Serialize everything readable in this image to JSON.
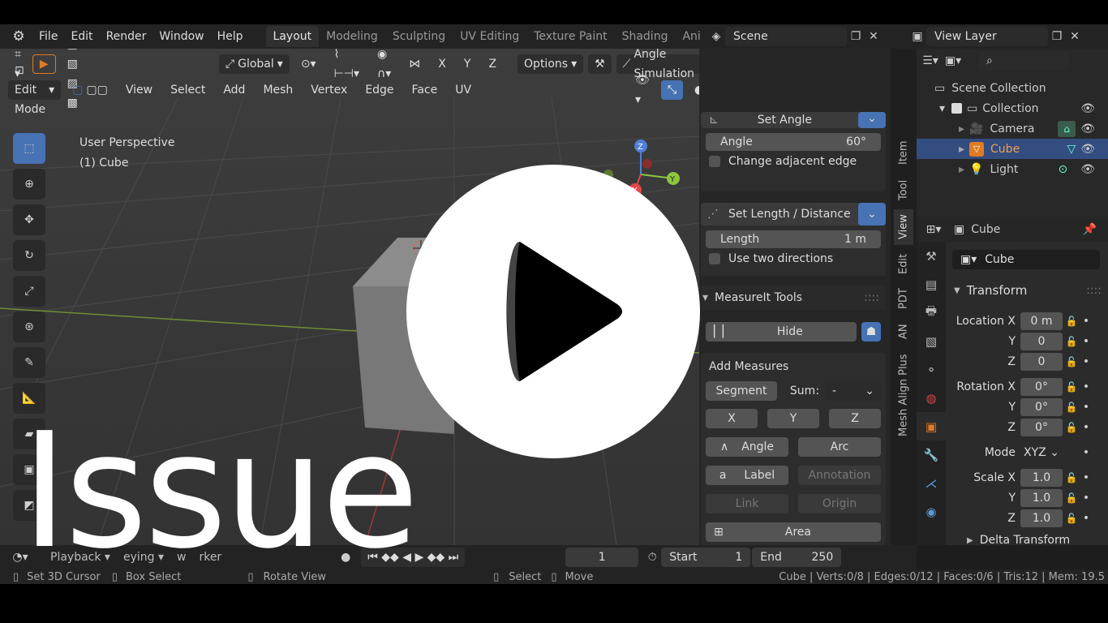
{
  "menu": [
    "File",
    "Edit",
    "Render",
    "Window",
    "Help"
  ],
  "workspaces": [
    "Layout",
    "Modeling",
    "Sculpting",
    "UV Editing",
    "Texture Paint",
    "Shading",
    "Ani"
  ],
  "scene": "Scene",
  "view_layer": "View Layer",
  "header1": {
    "transform": "Global",
    "options": "Options",
    "angle_sim": "Angle Simulation",
    "axes": [
      "X",
      "Y",
      "Z"
    ]
  },
  "header2": {
    "mode": "Edit Mode",
    "items": [
      "View",
      "Select",
      "Add",
      "Mesh",
      "Vertex",
      "Edge",
      "Face",
      "UV"
    ]
  },
  "viewport": {
    "perspective": "User Perspective",
    "object": "(1) Cube"
  },
  "sidebar": {
    "set_angle": "Set Angle",
    "angle_label": "Angle",
    "angle_value": "60°",
    "change_adjacent": "Change adjacent edge",
    "set_length": "Set Length / Distance",
    "length_label": "Length",
    "length_value": "1 m",
    "two_dirs": "Use two directions",
    "measureit": "MeasureIt Tools",
    "hide": "Hide",
    "add_measures": "Add Measures",
    "segment": "Segment",
    "sum": "Sum:",
    "sum_val": "-",
    "x": "X",
    "y": "Y",
    "z": "Z",
    "angle_btn": "Angle",
    "arc": "Arc",
    "label": "Label",
    "annotation": "Annotation",
    "link": "Link",
    "origin": "Origin",
    "area": "Area",
    "tabs": [
      "Item",
      "Tool",
      "View",
      "Edit",
      "PDT",
      "AN",
      "Mesh Align Plus"
    ]
  },
  "outliner": {
    "scene_collection": "Scene Collection",
    "collection": "Collection",
    "items": [
      "Camera",
      "Cube",
      "Light"
    ]
  },
  "properties": {
    "header_obj": "Cube",
    "name": "Cube",
    "transform": "Transform",
    "location_x": "Location X",
    "loc_x": "0 m",
    "loc_y": "0",
    "loc_z": "0",
    "rotation_x": "Rotation X",
    "rot_x": "0°",
    "rot_y": "0°",
    "rot_z": "0°",
    "mode": "Mode",
    "mode_val": "XYZ",
    "scale_x": "Scale X",
    "sc_x": "1.0",
    "sc_y": "1.0",
    "sc_z": "1.0",
    "delta": "Delta Transform",
    "y": "Y",
    "z": "Z"
  },
  "timeline": {
    "playback": "Playback",
    "keying": "eying",
    "view": "w",
    "marker": "rker",
    "frame": "1",
    "start_label": "Start",
    "start": "1",
    "end_label": "End",
    "end": "250"
  },
  "status": {
    "set_cursor": "Set 3D Cursor",
    "box_select": "Box Select",
    "rotate": "Rotate View",
    "select": "Select",
    "move": "Move",
    "stats": "Cube | Verts:0/8 | Edges:0/12 | Faces:0/6 | Tris:12 | Mem: 19.5"
  },
  "overlay_text": "Issue",
  "colors": {
    "accent": "#4772b3",
    "cube_orange": "#e07b22"
  }
}
